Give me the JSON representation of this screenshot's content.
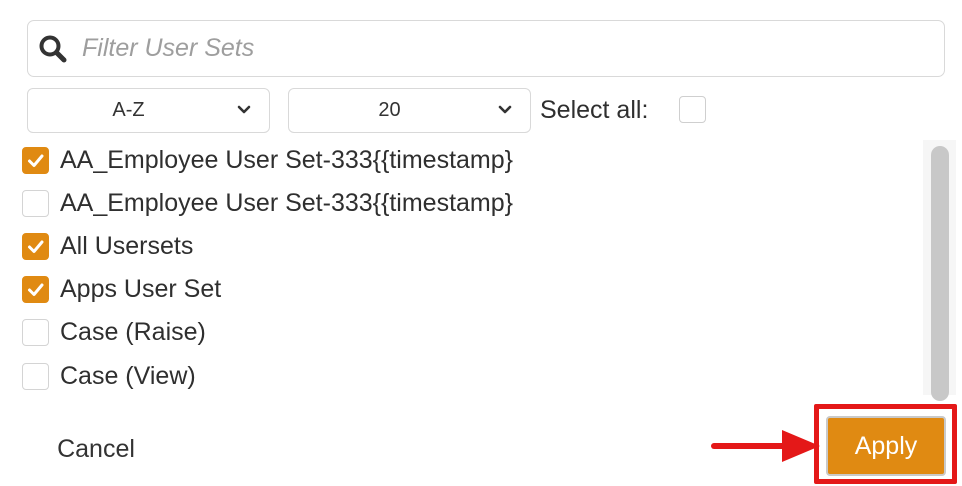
{
  "search": {
    "placeholder": "Filter User Sets",
    "value": ""
  },
  "sort_select": {
    "value": "A-Z"
  },
  "page_size_select": {
    "value": "20"
  },
  "select_all": {
    "label": "Select all:",
    "checked": false
  },
  "items": [
    {
      "label": "AA_Employee User Set-333{{timestamp}",
      "checked": true
    },
    {
      "label": "AA_Employee User Set-333{{timestamp}",
      "checked": false
    },
    {
      "label": "All Usersets",
      "checked": true
    },
    {
      "label": "Apps User Set",
      "checked": true
    },
    {
      "label": "Case (Raise)",
      "checked": false
    },
    {
      "label": "Case (View)",
      "checked": false
    }
  ],
  "footer": {
    "cancel_label": "Cancel",
    "apply_label": "Apply"
  },
  "colors": {
    "accent": "#e08a12",
    "highlight": "#e41818"
  },
  "icons": {
    "search": "search-icon",
    "dropdown": "chevron-down-icon",
    "check": "checkmark-icon",
    "annotation": "red-arrow-icon"
  }
}
